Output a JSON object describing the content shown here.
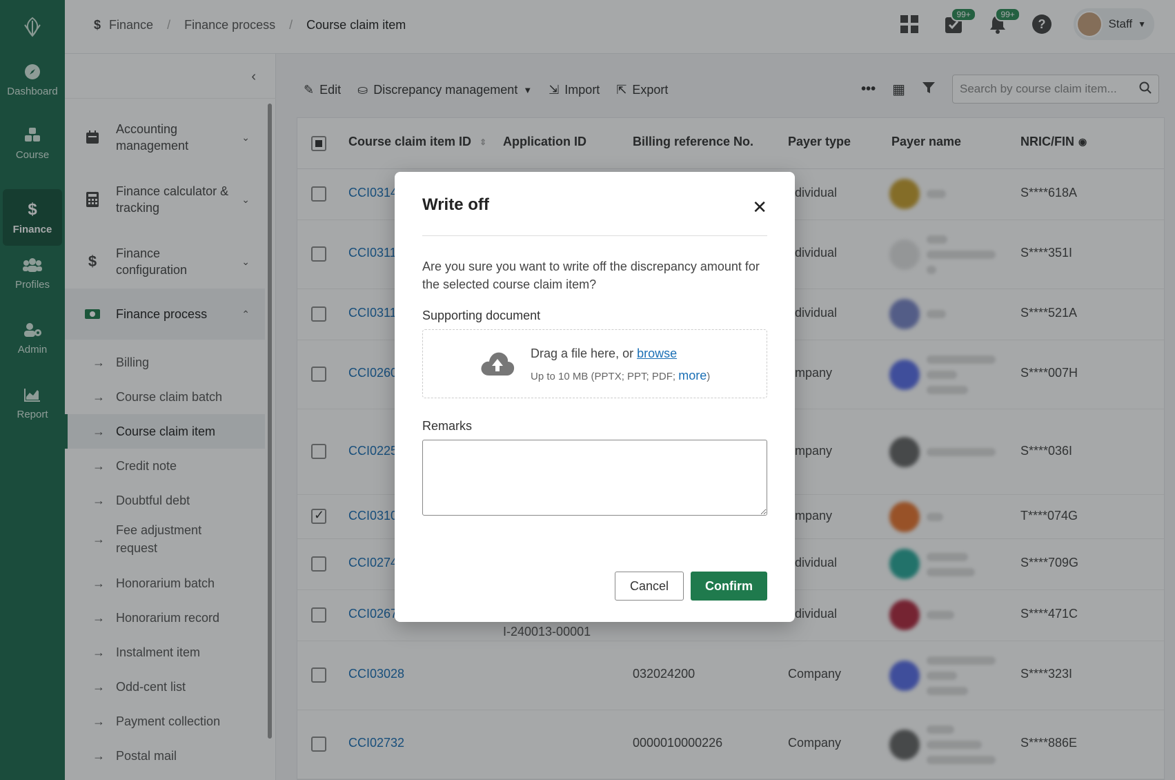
{
  "colors": {
    "rail": "#1f6b4f",
    "accent": "#1f7a4d",
    "link": "#1a6fb5"
  },
  "rail": {
    "items": [
      {
        "label": "Dashboard",
        "icon": "compass-icon"
      },
      {
        "label": "Course",
        "icon": "cubes-icon"
      },
      {
        "label": "Finance",
        "icon": "dollar-icon"
      },
      {
        "label": "Profiles",
        "icon": "users-icon"
      },
      {
        "label": "Admin",
        "icon": "user-gear-icon"
      },
      {
        "label": "Report",
        "icon": "chart-icon"
      }
    ]
  },
  "breadcrumb": {
    "items": [
      "Finance",
      "Finance process",
      "Course claim item"
    ]
  },
  "header": {
    "tasks_badge": "99+",
    "notif_badge": "99+",
    "user_label": "Staff"
  },
  "sidemenu": {
    "groups": [
      {
        "label": "Accounting management"
      },
      {
        "label": "Finance calculator & tracking"
      },
      {
        "label": "Finance configuration"
      },
      {
        "label": "Finance process"
      }
    ],
    "subitems": [
      "Billing",
      "Course claim batch",
      "Course claim item",
      "Credit note",
      "Doubtful debt",
      "Fee adjustment request",
      "Honorarium batch",
      "Honorarium record",
      "Instalment item",
      "Odd-cent list",
      "Payment collection",
      "Postal mail"
    ]
  },
  "toolbar": {
    "edit": "Edit",
    "discrepancy": "Discrepancy management",
    "import": "Import",
    "export": "Export",
    "search_placeholder": "Search by course claim item..."
  },
  "table": {
    "headers": [
      "Course claim item ID",
      "Application ID",
      "Billing reference No.",
      "Payer type",
      "Payer name",
      "NRIC/FIN"
    ],
    "rows": [
      {
        "id": "CCI0314",
        "app": "",
        "billing": "",
        "payer_type": "ndividual",
        "nric": "S****618A",
        "checked": false
      },
      {
        "id": "CCI0311",
        "app": "",
        "billing": "",
        "payer_type": "ndividual",
        "nric": "S****351I",
        "checked": false
      },
      {
        "id": "CCI0311",
        "app": "",
        "billing": "",
        "payer_type": "ndividual",
        "nric": "S****521A",
        "checked": false
      },
      {
        "id": "CCI0260",
        "app": "",
        "billing": "",
        "payer_type": "ompany",
        "nric": "S****007H",
        "checked": false
      },
      {
        "id": "CCI0225",
        "app": "",
        "billing": "",
        "payer_type": "ompany",
        "nric": "S****036I",
        "checked": false
      },
      {
        "id": "CCI0310",
        "app": "",
        "billing": "",
        "payer_type": "ompany",
        "nric": "T****074G",
        "checked": true
      },
      {
        "id": "CCI0274",
        "app": "",
        "billing": "",
        "payer_type": "ndividual",
        "nric": "S****709G",
        "checked": false
      },
      {
        "id": "CCI0267",
        "app": "I-240013-00001",
        "billing": "",
        "payer_type": "ndividual",
        "nric": "S****471C",
        "checked": false
      },
      {
        "id": "CCI03028",
        "app": "",
        "billing": "032024200",
        "payer_type": "Company",
        "nric": "S****323I",
        "checked": false
      },
      {
        "id": "CCI02732",
        "app": "",
        "billing": "0000010000226",
        "payer_type": "Company",
        "nric": "S****886E",
        "checked": false
      }
    ]
  },
  "modal": {
    "title": "Write off",
    "message": "Are you sure you want to write off the discrepancy amount for the selected course claim item?",
    "doc_label": "Supporting document",
    "drop_text": "Drag a file here, or ",
    "browse": "browse",
    "limits": "Up to 10 MB (PPTX; PPT; PDF; ",
    "more": "more",
    "limits_close": ")",
    "remarks_label": "Remarks",
    "remarks_value": "",
    "cancel": "Cancel",
    "confirm": "Confirm"
  }
}
